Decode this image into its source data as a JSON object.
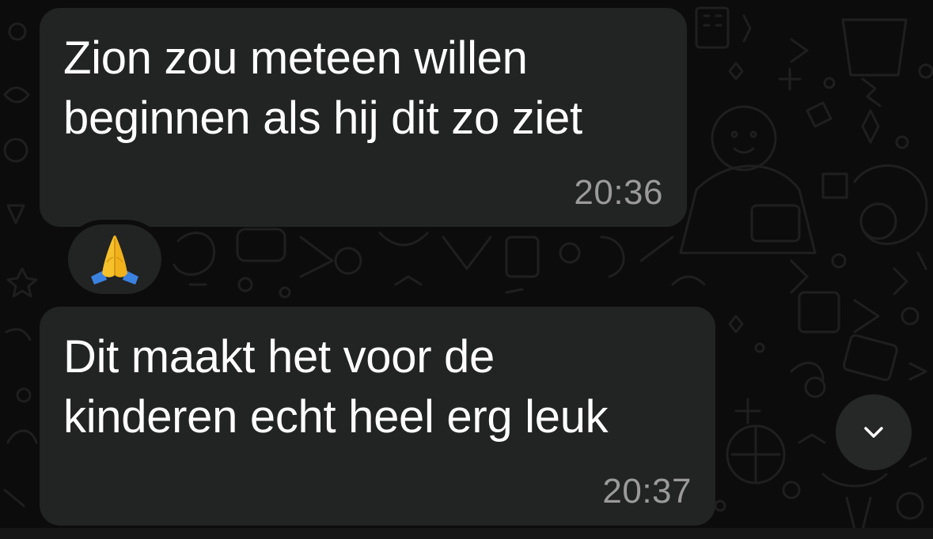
{
  "messages": [
    {
      "text": "Zion zou meteen willen\nbeginnen als hij dit zo ziet",
      "time": "20:36"
    },
    {
      "text": "Dit maakt het voor de\nkinderen echt heel erg leuk",
      "time": "20:37"
    }
  ],
  "reaction": {
    "emoji": "🙏",
    "icon": "folded-hands-icon"
  },
  "scroll_button": {
    "icon": "chevron-down-icon"
  },
  "colors": {
    "background": "#0c0c0c",
    "bubble": "#222323",
    "text": "#ffffff",
    "timestamp": "#9a9a9a"
  }
}
